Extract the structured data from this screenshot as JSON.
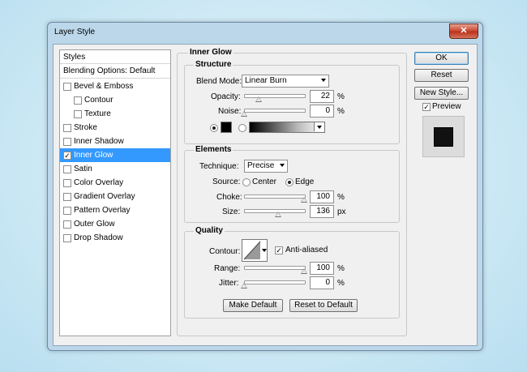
{
  "window": {
    "title": "Layer Style",
    "close_symbol": "✕"
  },
  "styles_panel": {
    "header": "Styles",
    "blending_options": "Blending Options: Default",
    "items": [
      {
        "label": "Bevel & Emboss",
        "checked": false,
        "indent": false
      },
      {
        "label": "Contour",
        "checked": false,
        "indent": true
      },
      {
        "label": "Texture",
        "checked": false,
        "indent": true
      },
      {
        "label": "Stroke",
        "checked": false,
        "indent": false
      },
      {
        "label": "Inner Shadow",
        "checked": false,
        "indent": false
      },
      {
        "label": "Inner Glow",
        "checked": true,
        "indent": false,
        "selected": true
      },
      {
        "label": "Satin",
        "checked": false,
        "indent": false
      },
      {
        "label": "Color Overlay",
        "checked": false,
        "indent": false
      },
      {
        "label": "Gradient Overlay",
        "checked": false,
        "indent": false
      },
      {
        "label": "Pattern Overlay",
        "checked": false,
        "indent": false
      },
      {
        "label": "Outer Glow",
        "checked": false,
        "indent": false
      },
      {
        "label": "Drop Shadow",
        "checked": false,
        "indent": false
      }
    ]
  },
  "inner_glow": {
    "title": "Inner Glow",
    "structure": {
      "legend": "Structure",
      "blend_mode_label": "Blend Mode:",
      "blend_mode_value": "Linear Burn",
      "opacity_label": "Opacity:",
      "opacity_value": "22",
      "opacity_unit": "%",
      "noise_label": "Noise:",
      "noise_value": "0",
      "noise_unit": "%",
      "color": "#000000"
    },
    "elements": {
      "legend": "Elements",
      "technique_label": "Technique:",
      "technique_value": "Precise",
      "source_label": "Source:",
      "source_center": "Center",
      "source_edge": "Edge",
      "choke_label": "Choke:",
      "choke_value": "100",
      "choke_unit": "%",
      "size_label": "Size:",
      "size_value": "136",
      "size_unit": "px"
    },
    "quality": {
      "legend": "Quality",
      "contour_label": "Contour:",
      "anti_aliased_label": "Anti-aliased",
      "anti_aliased_checked": true,
      "range_label": "Range:",
      "range_value": "100",
      "range_unit": "%",
      "jitter_label": "Jitter:",
      "jitter_value": "0",
      "jitter_unit": "%"
    },
    "make_default": "Make Default",
    "reset_to_default": "Reset to Default"
  },
  "buttons": {
    "ok": "OK",
    "reset": "Reset",
    "new_style": "New Style...",
    "preview_label": "Preview",
    "preview_checked": true
  }
}
